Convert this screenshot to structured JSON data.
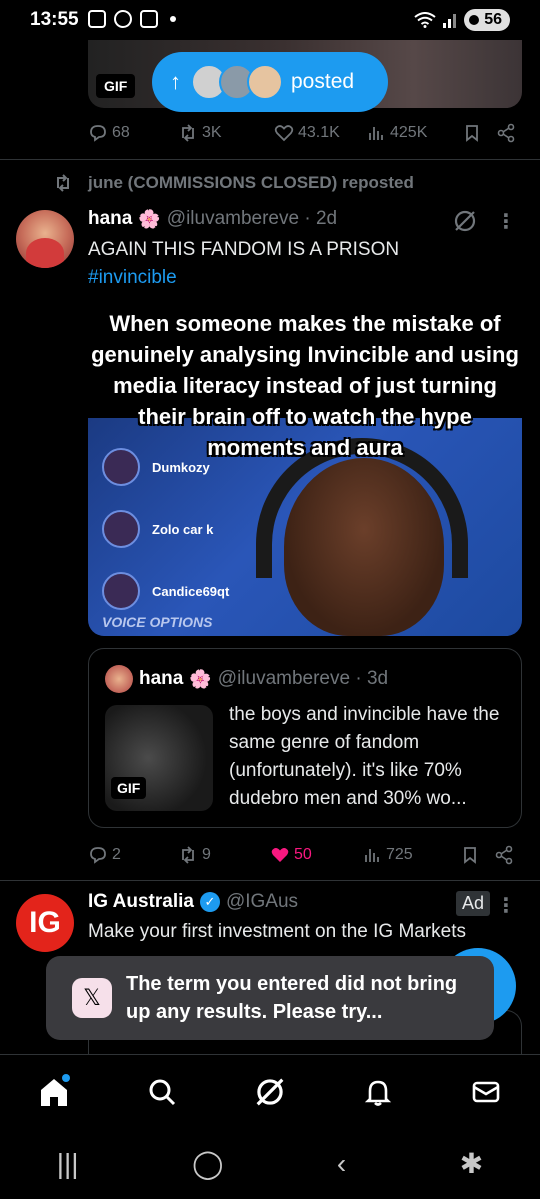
{
  "status_bar": {
    "time": "13:55",
    "battery": "56"
  },
  "top_tweet": {
    "gif_badge": "GIF",
    "posted_pill": {
      "arrow": "↑",
      "label": "posted"
    },
    "actions": {
      "replies": "68",
      "reposts": "3K",
      "likes": "43.1K",
      "views": "425K"
    }
  },
  "repost_banner": "june (COMMISSIONS CLOSED) reposted",
  "tweet1": {
    "name": "hana",
    "flower": "🌸",
    "handle": "@iluvambereve · 2d",
    "text": "AGAIN THIS FANDOM IS A PRISON",
    "hashtag": "#invincible",
    "more": "⋮",
    "meme": {
      "caption": "When someone makes the mistake of genuinely analysing Invincible and using media literacy instead of just turning their brain off to watch the hype moments and aura",
      "players": [
        "Dumkozy",
        "Zolo car k",
        "Candice69qt"
      ],
      "voice_options": "VOICE OPTIONS"
    },
    "quote": {
      "name": "hana",
      "flower": "🌸",
      "handle": "@iluvambereve · 3d",
      "gif_badge": "GIF",
      "text": "the boys and invincible have the same genre of fandom (unfortunately). it's like 70% dudebro men and 30% wo..."
    },
    "actions": {
      "replies": "2",
      "reposts": "9",
      "likes": "50",
      "views": "725"
    }
  },
  "ad_tweet": {
    "avatar_text": "IG",
    "name": "IG Australia",
    "handle": "@IGAus",
    "ad_label": "Ad",
    "more": "⋮",
    "text": "Make your first investment on the IG Markets"
  },
  "toast": {
    "icon": "𝕏",
    "text": "The term you entered did not bring up any results. Please try..."
  },
  "fab": {
    "label": "+"
  },
  "system_nav": {
    "recents": "|||",
    "home": "◯",
    "back": "‹",
    "accessibility": "✱"
  },
  "colors": {
    "accent": "#1d9bf0",
    "like": "#f91880",
    "muted": "#71767b"
  }
}
